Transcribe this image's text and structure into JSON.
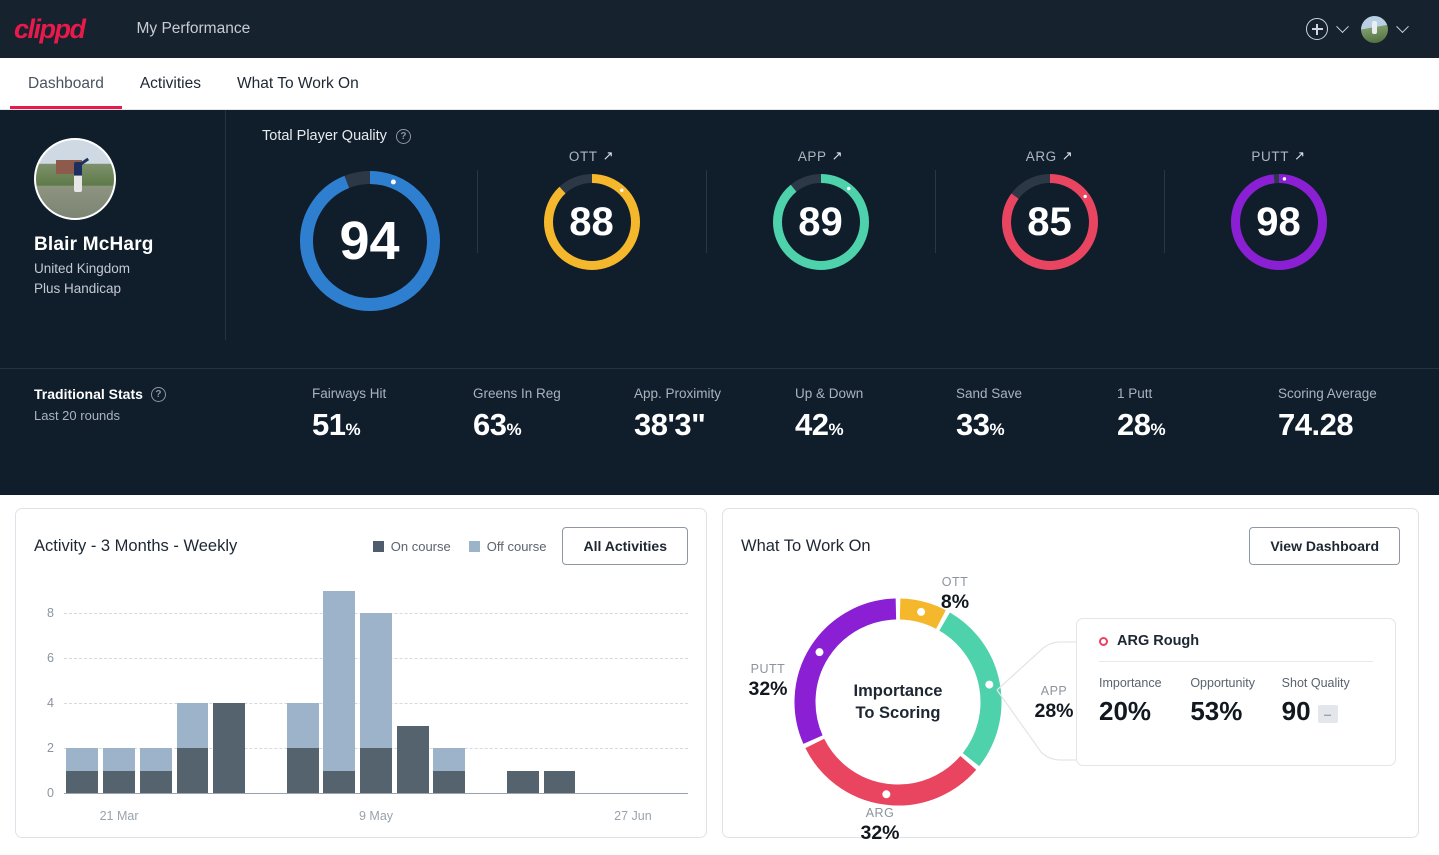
{
  "header": {
    "brand": "clippd",
    "nav_title": "My Performance",
    "add_icon": "plus-circle-icon",
    "chevron_icon": "chevron-down-icon",
    "avatar_icon": "user-avatar"
  },
  "tabs": [
    {
      "label": "Dashboard",
      "active": true
    },
    {
      "label": "Activities",
      "active": false
    },
    {
      "label": "What To Work On",
      "active": false
    }
  ],
  "profile": {
    "name": "Blair McHarg",
    "country": "United Kingdom",
    "handicap": "Plus Handicap"
  },
  "tpq": {
    "title": "Total Player Quality",
    "help_icon": "question-mark-icon",
    "gauges": [
      {
        "label": "",
        "value": "94",
        "color": "#2f7fd1",
        "pct": 94,
        "trend": ""
      },
      {
        "label": "OTT",
        "value": "88",
        "color": "#f5b72b",
        "pct": 88,
        "trend": "↗"
      },
      {
        "label": "APP",
        "value": "89",
        "color": "#4dd2ab",
        "pct": 89,
        "trend": "↗"
      },
      {
        "label": "ARG",
        "value": "85",
        "color": "#ea4560",
        "pct": 85,
        "trend": "↗"
      },
      {
        "label": "PUTT",
        "value": "98",
        "color": "#8b1fd4",
        "pct": 98,
        "trend": "↗"
      }
    ]
  },
  "traditional_stats": {
    "title": "Traditional Stats",
    "help_icon": "question-mark-icon",
    "subtitle": "Last 20 rounds",
    "stats": [
      {
        "label": "Fairways Hit",
        "value": "51",
        "unit": "%"
      },
      {
        "label": "Greens In Reg",
        "value": "63",
        "unit": "%"
      },
      {
        "label": "App. Proximity",
        "value": "38'3\"",
        "unit": ""
      },
      {
        "label": "Up & Down",
        "value": "42",
        "unit": "%"
      },
      {
        "label": "Sand Save",
        "value": "33",
        "unit": "%"
      },
      {
        "label": "1 Putt",
        "value": "28",
        "unit": "%"
      },
      {
        "label": "Scoring Average",
        "value": "74.28",
        "unit": ""
      }
    ]
  },
  "activity_card": {
    "title": "Activity - 3 Months - Weekly",
    "legend": [
      {
        "label": "On course",
        "color": "#4e5c6b"
      },
      {
        "label": "Off course",
        "color": "#9cb3c9"
      }
    ],
    "button": "All Activities"
  },
  "wtwo_card": {
    "title": "What To Work On",
    "button": "View Dashboard",
    "center_line1": "Importance",
    "center_line2": "To Scoring",
    "detail": {
      "marker_icon": "circle-outline-icon",
      "title": "ARG Rough",
      "metrics": [
        {
          "label": "Importance",
          "value": "20%",
          "chip": ""
        },
        {
          "label": "Opportunity",
          "value": "53%",
          "chip": ""
        },
        {
          "label": "Shot Quality",
          "value": "90",
          "chip": "–"
        }
      ]
    }
  },
  "chart_data": [
    {
      "type": "bar",
      "title": "Activity - 3 Months - Weekly",
      "stacked": true,
      "xlabel": "",
      "ylabel": "",
      "ylim": [
        0,
        9
      ],
      "yticks": [
        0,
        2,
        4,
        6,
        8
      ],
      "grid": true,
      "legend_position": "top-right",
      "categories": [
        "w1",
        "w2",
        "w3",
        "w4",
        "w5",
        "w6",
        "w7",
        "w8",
        "w9",
        "w10",
        "w11",
        "w12",
        "w13",
        "w14",
        "w15",
        "w16",
        "w17"
      ],
      "tick_labels": [
        "21 Mar",
        "9 May",
        "27 Jun"
      ],
      "tick_positions": [
        1,
        8,
        15
      ],
      "series": [
        {
          "name": "On course",
          "color": "#55636f",
          "values": [
            1,
            1,
            1,
            2,
            4,
            0,
            2,
            1,
            2,
            3,
            1,
            0,
            1,
            1,
            0,
            0,
            0
          ]
        },
        {
          "name": "Off course",
          "color": "#9cb3c9",
          "values": [
            1,
            1,
            1,
            2,
            0,
            0,
            2,
            8,
            6,
            0,
            1,
            0,
            0,
            0,
            0,
            0,
            0
          ]
        }
      ],
      "totals": [
        2,
        2,
        2,
        4,
        4,
        0,
        4,
        9,
        8,
        3,
        2,
        0,
        1,
        1,
        0,
        0,
        0
      ]
    },
    {
      "type": "pie",
      "title": "Importance To Scoring",
      "donut": true,
      "legend_position": "around",
      "categories": [
        "OTT",
        "APP",
        "ARG",
        "PUTT"
      ],
      "values": [
        8,
        28,
        32,
        32
      ],
      "labels": [
        "8%",
        "28%",
        "32%",
        "32%"
      ],
      "colors": [
        "#f5b72b",
        "#4dd2ab",
        "#ea4560",
        "#8b1fd4"
      ]
    }
  ]
}
